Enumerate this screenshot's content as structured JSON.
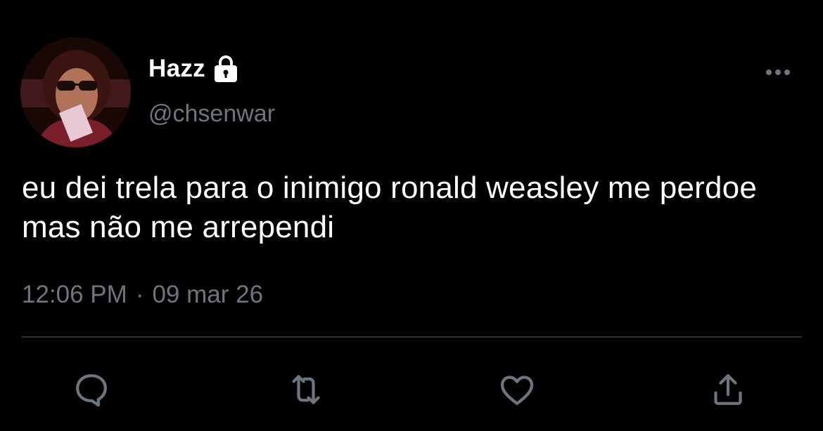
{
  "tweet": {
    "author": {
      "display_name": "Hazz",
      "handle": "@chsenwar",
      "protected": true
    },
    "text": "eu dei trela para o inimigo ronald weasley me perdoe mas não me arrependi",
    "time": "12:06 PM",
    "separator": "·",
    "date": "09 mar 26"
  },
  "actions": {
    "reply": "reply-icon",
    "retweet": "retweet-icon",
    "like": "heart-icon",
    "share": "share-icon"
  },
  "colors": {
    "background": "#000000",
    "text": "#ffffff",
    "secondary": "#6e767d",
    "divider": "#2f3336",
    "icon": "#6e767d"
  }
}
